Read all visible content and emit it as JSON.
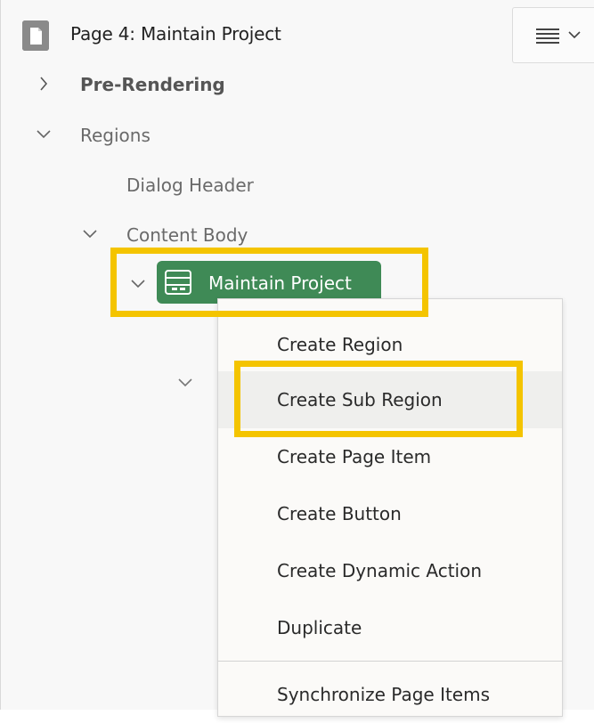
{
  "header": {
    "page_title": "Page 4: Maintain Project",
    "page_icon": "page-icon",
    "menu_icon": "hamburger-menu-icon"
  },
  "tree": {
    "pre_rendering": "Pre-Rendering",
    "regions": "Regions",
    "dialog_header": "Dialog Header",
    "content_body": "Content Body",
    "selected_region": "Maintain Project"
  },
  "context_menu": {
    "items": [
      "Create Region",
      "Create Sub Region",
      "Create Page Item",
      "Create Button",
      "Create Dynamic Action",
      "Duplicate",
      "Synchronize Page Items"
    ],
    "hovered_item": "Create Sub Region"
  },
  "colors": {
    "selected_badge": "#3f8a56",
    "highlight": "#f4c400",
    "panel_bg": "#f8f8f8"
  }
}
